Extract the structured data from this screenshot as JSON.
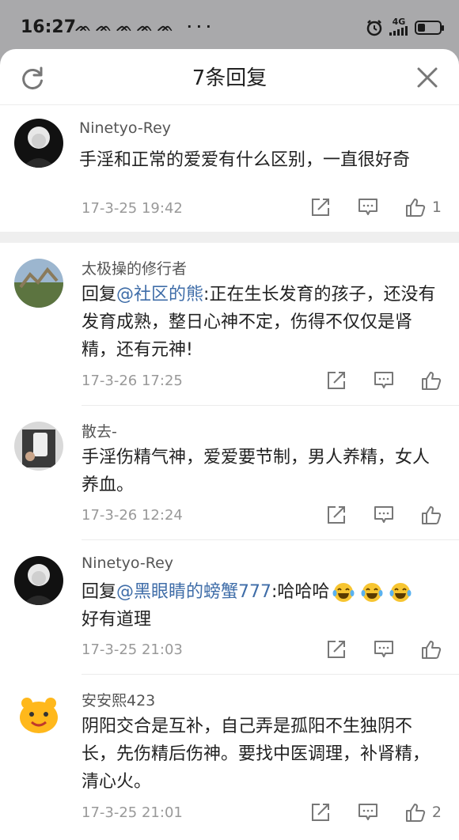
{
  "status": {
    "time": "16:27",
    "notifications": "ᨏᨏᨏᨏᨏ ···",
    "network": "4G",
    "battery_level": 0.35
  },
  "header": {
    "title": "7条回复"
  },
  "main_comment": {
    "username": "Ninetyo-Rey",
    "content": "手淫和正常的爱爱有什么区别，一直很好奇",
    "time": "17-3-25 19:42",
    "like_count": "1"
  },
  "replies": [
    {
      "username": "太极操的修行者",
      "prefix": "回复",
      "mention": "@社区的熊",
      "text": ":正在生长发育的孩子，还没有发育成熟，整日心神不定，伤得不仅仅是肾精，还有元神!",
      "time": "17-3-26 17:25"
    },
    {
      "username": "散去-",
      "text": "手淫伤精气神，爱爱要节制，男人养精，女人养血。",
      "time": "17-3-26 12:24"
    },
    {
      "username": "Ninetyo-Rey",
      "prefix": "回复",
      "mention": "@黑眼睛的螃蟹777",
      "text": ":哈哈哈",
      "text2": "好有道理",
      "time": "17-3-25 21:03"
    },
    {
      "username": "安安熙423",
      "text": "阴阳交合是互补，自己弄是孤阳不生独阴不长，先伤精后伤神。要找中医调理，补肾精，清心火。",
      "time": "17-3-25 21:01",
      "like_count": "2"
    }
  ]
}
